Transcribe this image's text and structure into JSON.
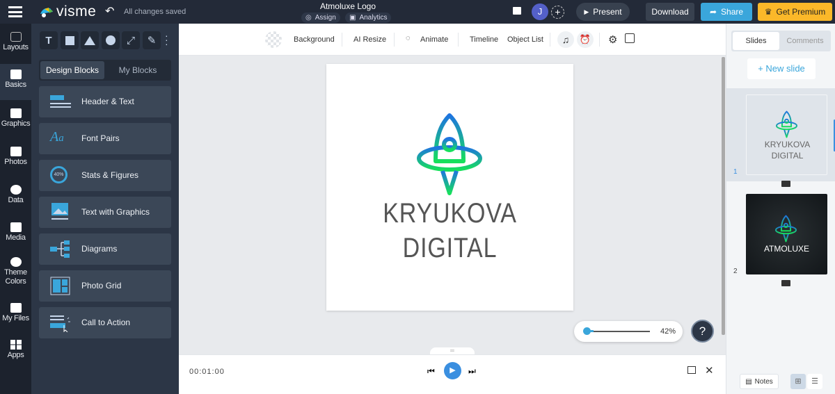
{
  "header": {
    "logo": "visme",
    "save_status": "All changes saved",
    "title": "Atmoluxe Logo",
    "assign": "Assign",
    "analytics": "Analytics",
    "avatar_initial": "J",
    "present": "Present",
    "download": "Download",
    "share": "Share",
    "premium": "Get Premium"
  },
  "rail": [
    {
      "label": "Layouts",
      "icon": "layouts-icon"
    },
    {
      "label": "Basics",
      "icon": "basics-icon"
    },
    {
      "label": "Graphics",
      "icon": "graphics-icon"
    },
    {
      "label": "Photos",
      "icon": "photos-icon"
    },
    {
      "label": "Data",
      "icon": "data-icon"
    },
    {
      "label": "Media",
      "icon": "media-icon"
    },
    {
      "label": "Theme Colors",
      "icon": "palette-icon"
    },
    {
      "label": "My Files",
      "icon": "folder-icon"
    },
    {
      "label": "Apps",
      "icon": "apps-icon"
    }
  ],
  "panel": {
    "tabs": [
      "Design Blocks",
      "My Blocks"
    ],
    "blocks": [
      "Header & Text",
      "Font Pairs",
      "Stats & Figures",
      "Text with Graphics",
      "Diagrams",
      "Photo Grid",
      "Call to Action"
    ],
    "stats_badge": "40%"
  },
  "toolbar": {
    "background": "Background",
    "ai_resize": "AI Resize",
    "animate": "Animate",
    "timeline": "Timeline",
    "object_list": "Object List"
  },
  "canvas": {
    "line1": "KRYUKOVA",
    "line2": "DIGITAL",
    "zoom": "42%",
    "zoom_level": 42
  },
  "timeline": {
    "time": "00:01:00"
  },
  "right": {
    "tabs": [
      "Slides",
      "Comments"
    ],
    "new_slide": "+ New slide",
    "slides": [
      {
        "num": "1",
        "line1": "KRYUKOVA",
        "line2": "DIGITAL"
      },
      {
        "num": "2",
        "line1": "ATMOLUXE"
      }
    ],
    "notes": "Notes"
  },
  "colors": {
    "accent": "#3aa6db",
    "premium": "#fbb829",
    "rocket_top": "#1e74e0",
    "rocket_bottom": "#17e05c"
  }
}
